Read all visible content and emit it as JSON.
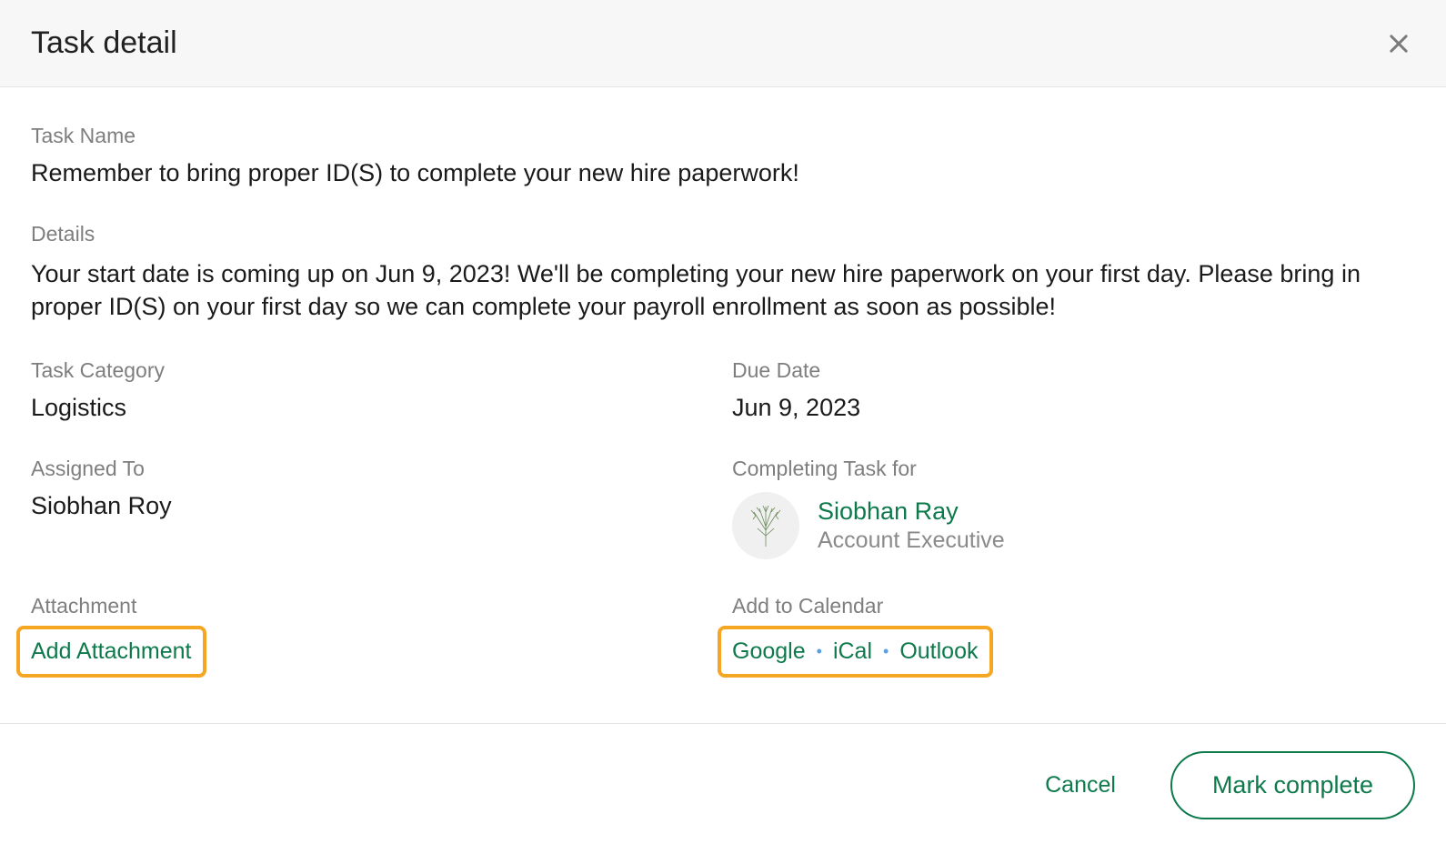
{
  "header": {
    "title": "Task detail"
  },
  "task": {
    "name_label": "Task Name",
    "name": "Remember to bring proper ID(S) to complete your new hire paperwork!",
    "details_label": "Details",
    "details": "Your start date is coming up on Jun 9, 2023! We'll be completing your new hire paperwork on your first day. Please bring in proper ID(S) on your first day so we can complete your payroll enrollment as soon as possible!",
    "category_label": "Task Category",
    "category": "Logistics",
    "due_date_label": "Due Date",
    "due_date": "Jun 9, 2023",
    "assigned_to_label": "Assigned To",
    "assigned_to": "Siobhan Roy",
    "completing_for_label": "Completing Task for",
    "completing_for": {
      "name": "Siobhan Ray",
      "title": "Account Executive"
    },
    "attachment_label": "Attachment",
    "add_attachment_label": "Add Attachment",
    "calendar_label": "Add to Calendar",
    "calendar_links": {
      "google": "Google",
      "ical": "iCal",
      "outlook": "Outlook"
    }
  },
  "footer": {
    "cancel": "Cancel",
    "complete": "Mark complete"
  }
}
